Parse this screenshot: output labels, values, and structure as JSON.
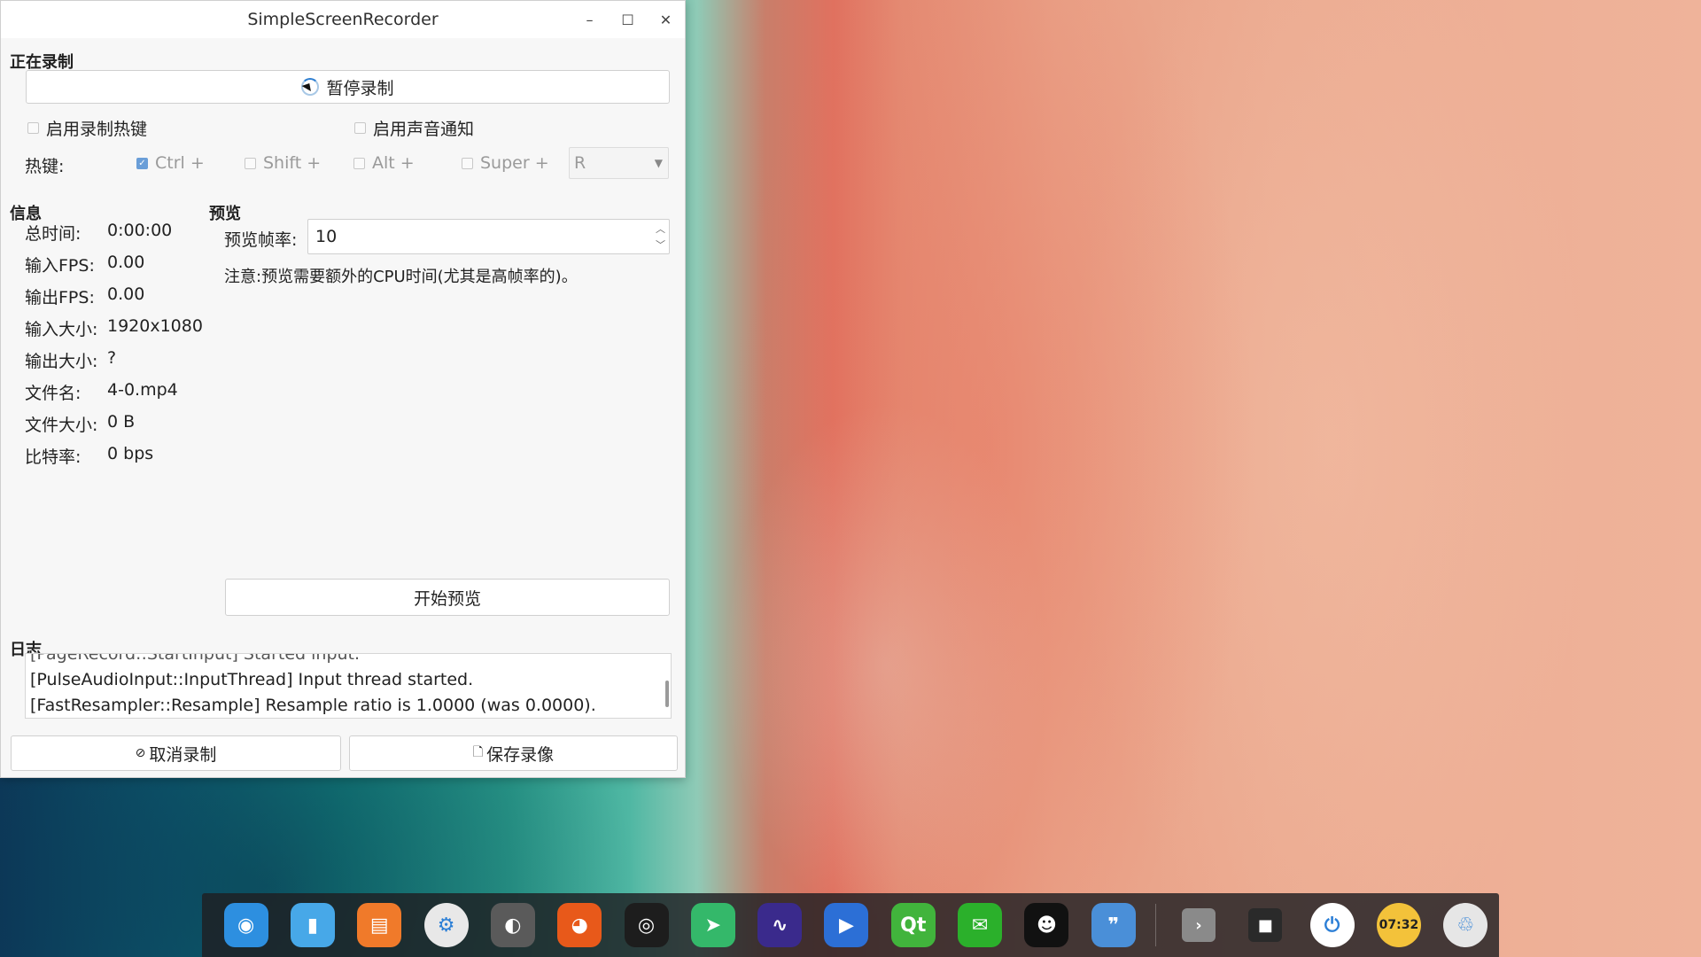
{
  "window": {
    "title": "SimpleScreenRecorder",
    "controls": [
      "–",
      "☐",
      "✕"
    ]
  },
  "recording": {
    "section_title": "正在录制",
    "pause_button": "暂停录制",
    "enable_hotkey": "启用录制热键",
    "enable_sound": "启用声音通知",
    "hotkey_label": "热键:",
    "modifiers": [
      {
        "label": "Ctrl +",
        "checked": true
      },
      {
        "label": "Shift +",
        "checked": false
      },
      {
        "label": "Alt +",
        "checked": false
      },
      {
        "label": "Super +",
        "checked": false
      }
    ],
    "key": "R"
  },
  "info": {
    "section_title": "信息",
    "rows": [
      {
        "key": "总时间:",
        "value": "0:00:00"
      },
      {
        "key": "输入FPS:",
        "value": "0.00"
      },
      {
        "key": "输出FPS:",
        "value": "0.00"
      },
      {
        "key": "输入大小:",
        "value": "1920x1080"
      },
      {
        "key": "输出大小:",
        "value": "?"
      },
      {
        "key": "文件名:",
        "value": "4-0.mp4"
      },
      {
        "key": "文件大小:",
        "value": "0 B"
      },
      {
        "key": "比特率:",
        "value": "0 bps"
      }
    ]
  },
  "preview": {
    "section_title": "预览",
    "fps_label": "预览帧率:",
    "fps_value": "10",
    "note": "注意:预览需要额外的CPU时间(尤其是高帧率的)。",
    "start_button": "开始预览"
  },
  "log": {
    "section_title": "日志",
    "lines": [
      "[PageRecord::StartInput] Started input.",
      "[PulseAudioInput::InputThread] Input thread started.",
      "[FastResampler::Resample] Resample ratio is 1.0000 (was 0.0000)."
    ]
  },
  "actions": {
    "cancel": "取消录制",
    "save": "保存录像"
  },
  "dock": {
    "items": [
      {
        "name": "deepin-launcher-icon",
        "color": "#2d8fe0"
      },
      {
        "name": "file-manager-icon",
        "color": "#47a8e8"
      },
      {
        "name": "app-store-icon",
        "color": "#f07a2a"
      },
      {
        "name": "settings-icon",
        "color": "#e8e8e8"
      },
      {
        "name": "steam-icon",
        "color": "#5a5a5a"
      },
      {
        "name": "firefox-icon",
        "color": "#e8591a"
      },
      {
        "name": "camera-icon",
        "color": "#1d1d1d"
      },
      {
        "name": "telegram-icon",
        "color": "#34b86a"
      },
      {
        "name": "system-monitor-icon",
        "color": "#3a2a8c"
      },
      {
        "name": "video-editor-icon",
        "color": "#2c6fd6"
      },
      {
        "name": "qt-creator-icon",
        "color": "#41b43c"
      },
      {
        "name": "wechat-icon",
        "color": "#2bb02b"
      },
      {
        "name": "qq-icon",
        "color": "#111111"
      },
      {
        "name": "notes-icon",
        "color": "#4a8fd8"
      },
      {
        "name": "show-desktop-icon",
        "color": "#8a8a8a"
      },
      {
        "name": "screen-recorder-icon",
        "color": "#2a2a2a"
      },
      {
        "name": "power-icon",
        "color": "#ffffff"
      },
      {
        "name": "clock-icon",
        "color": "#f3c23a"
      },
      {
        "name": "trash-icon",
        "color": "#e6e6e6"
      }
    ],
    "clock_text": "07:32"
  }
}
